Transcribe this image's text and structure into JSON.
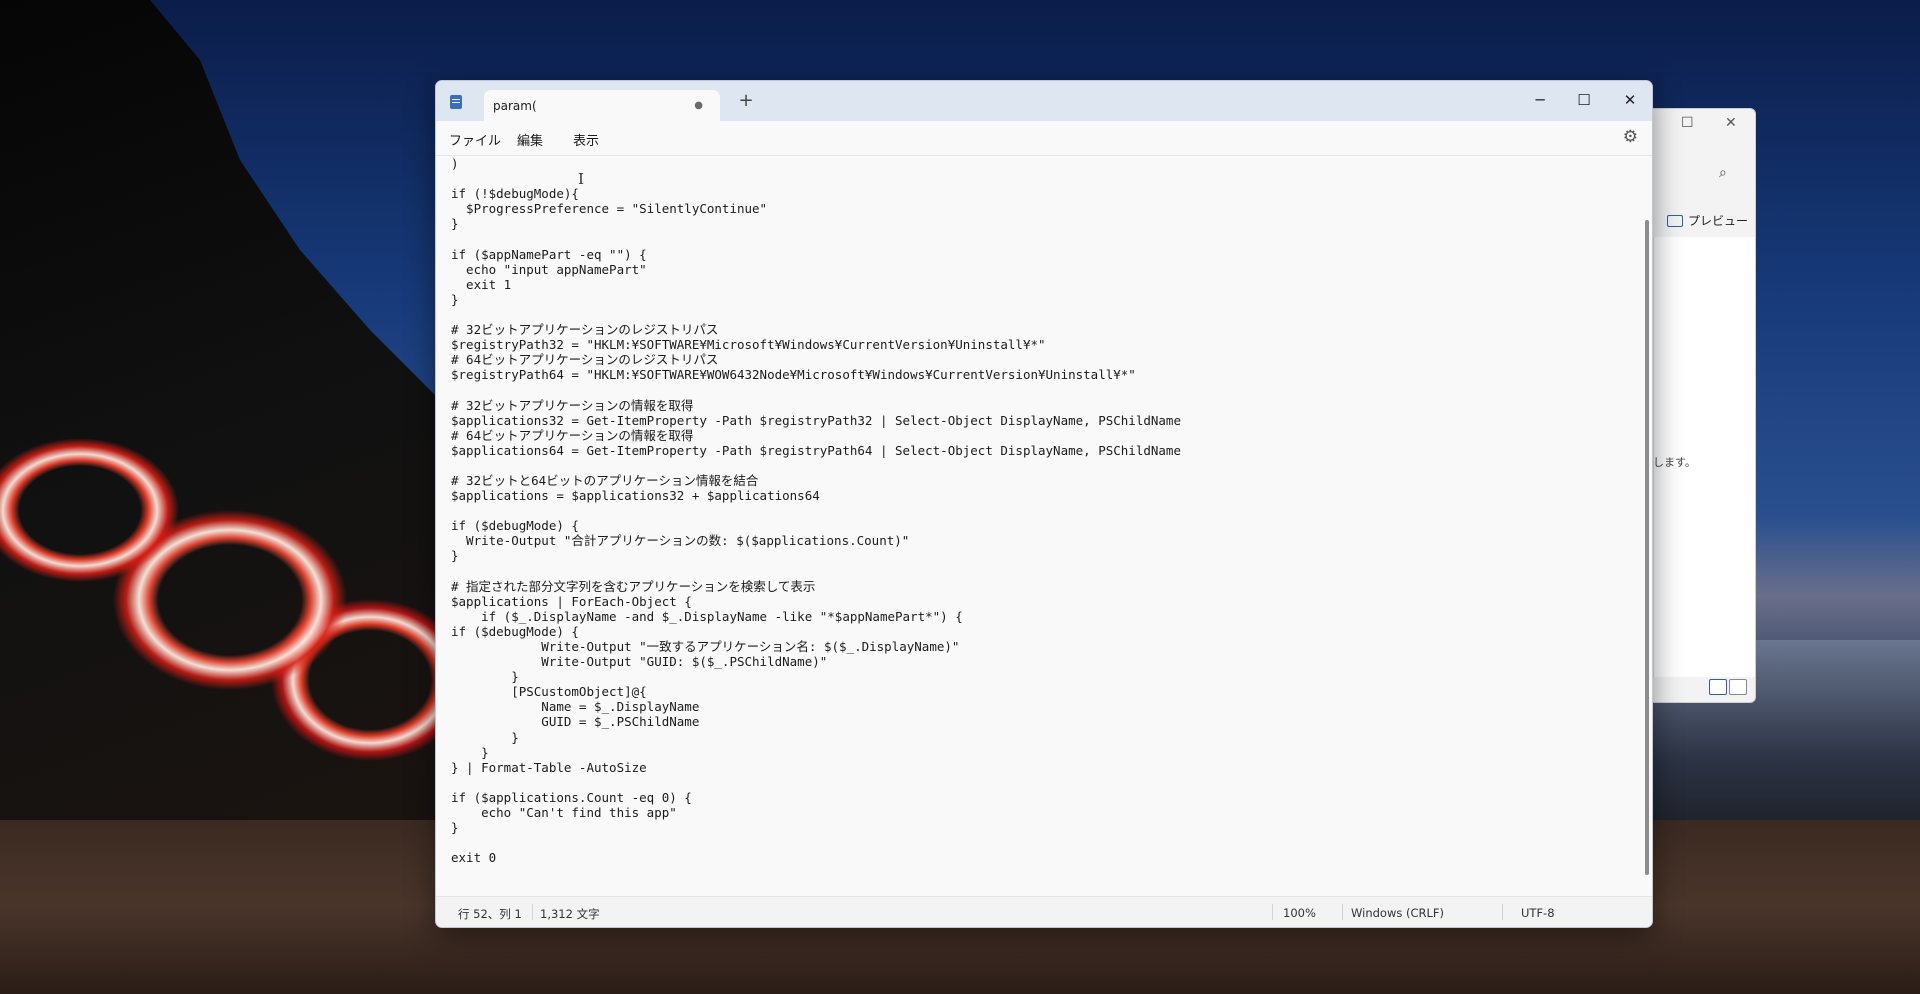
{
  "background_window": {
    "preview_label": "プレビュー",
    "message_fragment": "します。"
  },
  "window": {
    "tab_title": "param(",
    "new_tab_symbol": "+",
    "menu": [
      "ファイル",
      "編集",
      "表示"
    ],
    "code_lines": [
      ")",
      "",
      "if (!$debugMode){",
      "  $ProgressPreference = \"SilentlyContinue\"",
      "}",
      "",
      "if ($appNamePart -eq \"\") {",
      "  echo \"input appNamePart\"",
      "  exit 1",
      "}",
      "",
      "# 32ビットアプリケーションのレジストリパス",
      "$registryPath32 = \"HKLM:¥SOFTWARE¥Microsoft¥Windows¥CurrentVersion¥Uninstall¥*\"",
      "# 64ビットアプリケーションのレジストリパス",
      "$registryPath64 = \"HKLM:¥SOFTWARE¥WOW6432Node¥Microsoft¥Windows¥CurrentVersion¥Uninstall¥*\"",
      "",
      "# 32ビットアプリケーションの情報を取得",
      "$applications32 = Get-ItemProperty -Path $registryPath32 | Select-Object DisplayName, PSChildName",
      "# 64ビットアプリケーションの情報を取得",
      "$applications64 = Get-ItemProperty -Path $registryPath64 | Select-Object DisplayName, PSChildName",
      "",
      "# 32ビットと64ビットのアプリケーション情報を結合",
      "$applications = $applications32 + $applications64",
      "",
      "if ($debugMode) {",
      "  Write-Output \"合計アプリケーションの数: $($applications.Count)\"",
      "}",
      "",
      "# 指定された部分文字列を含むアプリケーションを検索して表示",
      "$applications | ForEach-Object {",
      "    if ($_.DisplayName -and $_.DisplayName -like \"*$appNamePart*\") {",
      "if ($debugMode) {",
      "            Write-Output \"一致するアプリケーション名: $($_.DisplayName)\"",
      "            Write-Output \"GUID: $($_.PSChildName)\"",
      "        }",
      "        [PSCustomObject]@{",
      "            Name = $_.DisplayName",
      "            GUID = $_.PSChildName",
      "        }",
      "    }",
      "} | Format-Table -AutoSize",
      "",
      "if ($applications.Count -eq 0) {",
      "    echo \"Can't find this app\"",
      "}",
      "",
      "exit 0",
      ""
    ],
    "status": {
      "position": "行 52、列 1",
      "char_count": "1,312 文字",
      "zoom": "100%",
      "line_ending": "Windows (CRLF)",
      "encoding": "UTF-8"
    }
  }
}
